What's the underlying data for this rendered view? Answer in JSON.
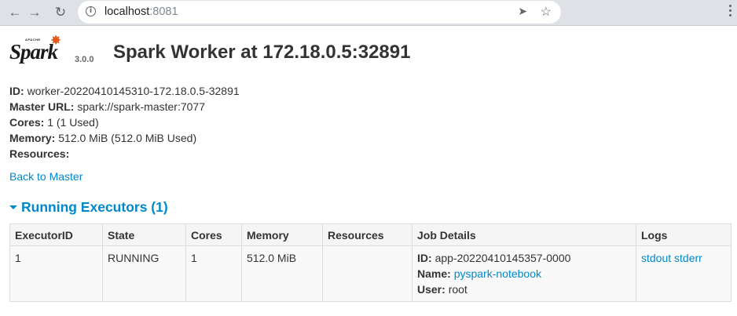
{
  "browser": {
    "url_host": "localhost",
    "url_port": ":8081"
  },
  "header": {
    "logo_apache": "APACHE",
    "logo_text": "Spark",
    "version": "3.0.0",
    "title": "Spark Worker at 172.18.0.5:32891"
  },
  "summary": {
    "id_label": "ID:",
    "id_value": "worker-20220410145310-172.18.0.5-32891",
    "master_label": "Master URL:",
    "master_value": "spark://spark-master:7077",
    "cores_label": "Cores:",
    "cores_value": "1 (1 Used)",
    "memory_label": "Memory:",
    "memory_value": "512.0 MiB (512.0 MiB Used)",
    "resources_label": "Resources:"
  },
  "back_link": "Back to Master",
  "section": {
    "title": "Running Executors (1)"
  },
  "table": {
    "headers": [
      "ExecutorID",
      "State",
      "Cores",
      "Memory",
      "Resources",
      "Job Details",
      "Logs"
    ],
    "row": {
      "executor_id": "1",
      "state": "RUNNING",
      "cores": "1",
      "memory": "512.0 MiB",
      "resources": "",
      "job_id_label": "ID:",
      "job_id_value": "app-20220410145357-0000",
      "job_name_label": "Name:",
      "job_name_value": "pyspark-notebook",
      "job_user_label": "User:",
      "job_user_value": "root",
      "stdout": "stdout",
      "stderr": "stderr"
    }
  },
  "colors": {
    "link": "#0088cc",
    "logo_accent": "#e25a1c"
  }
}
